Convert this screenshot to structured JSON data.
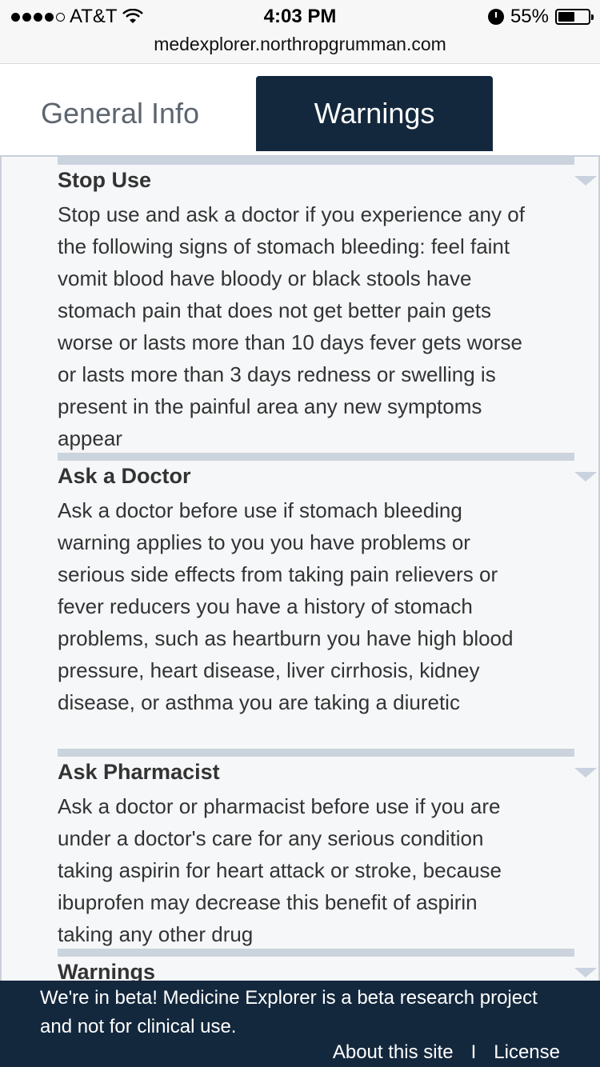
{
  "status_bar": {
    "carrier": "AT&T",
    "time": "4:03 PM",
    "battery_percent": "55%",
    "battery_level": 0.55,
    "signal_bars": 4
  },
  "url_bar": {
    "url": "medexplorer.northropgrumman.com"
  },
  "tabs": [
    {
      "label": "General Info",
      "active": false
    },
    {
      "label": "Warnings",
      "active": true
    }
  ],
  "sections": [
    {
      "title": "Stop Use",
      "body": "Stop use and ask a doctor if you experience any of the following signs of stomach bleeding: feel faint vomit blood have bloody or black stools have stomach pain that does not get better pain gets worse or lasts more than 10 days fever gets worse or lasts more than 3 days redness or swelling is present in the painful area any new symptoms appear"
    },
    {
      "title": "Ask a Doctor",
      "body": "Ask a doctor before use if stomach bleeding warning applies to you you have problems or serious side effects from taking pain relievers or fever reducers you have a history of stomach problems, such as heartburn you have high blood pressure, heart disease, liver cirrhosis, kidney disease, or asthma you are taking a diuretic"
    },
    {
      "title": "Ask Pharmacist",
      "body": "Ask a doctor or pharmacist before use if you are under a doctor's care for any serious condition taking aspirin for heart attack or stroke, because ibuprofen may decrease this benefit of aspirin taking any other drug"
    },
    {
      "title": "Warnings",
      "body": ""
    }
  ],
  "footer": {
    "message": "We're in beta! Medicine Explorer is a beta research project and not for clinical use.",
    "about_link": "About this site",
    "separator": "I",
    "license_link": "License"
  },
  "colors": {
    "navy": "#14283d",
    "section_bar": "#cbd3de",
    "content_bg": "#f6f7f8"
  }
}
